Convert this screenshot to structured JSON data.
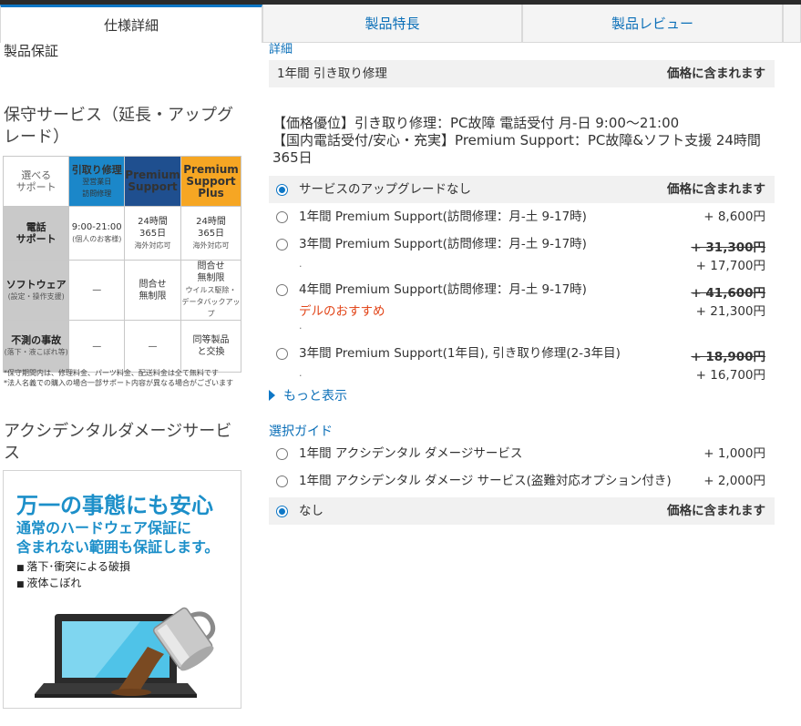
{
  "tabs": [
    {
      "label": "仕様詳細"
    },
    {
      "label": "製品特長"
    },
    {
      "label": "製品レビュー"
    }
  ],
  "left": {
    "warranty_heading": "製品保証",
    "maintenance_heading": "保守サービス（延長・アップグレード）",
    "table": {
      "corner": "選べる\nサポート",
      "col1": {
        "title": "引取り修理",
        "sub": "翌営業日\n訪問修理"
      },
      "col2": {
        "title": "Premium\nSupport"
      },
      "col3": {
        "title": "Premium\nSupport\nPlus"
      },
      "rows": [
        {
          "head": "電話\nサポート",
          "sub": "",
          "c1": "9:00-21:00",
          "c1s": "(個人のお客様)",
          "c2": "24時間\n365日",
          "c2s": "海外対応可",
          "c3": "24時間\n365日",
          "c3s": "海外対応可"
        },
        {
          "head": "ソフトウェア",
          "sub": "(設定・操作支援)",
          "c1": "—",
          "c1s": "",
          "c2": "問合せ\n無制限",
          "c2s": "",
          "c3": "問合せ\n無制限",
          "c3s": "ウイルス駆除・\nデータバックアップ"
        },
        {
          "head": "不測の事故",
          "sub": "(落下・液こぼれ等)",
          "c1": "—",
          "c1s": "",
          "c2": "—",
          "c2s": "",
          "c3": "同等製品\nと交換",
          "c3s": ""
        }
      ],
      "notes": "*保守期間内は、修理料金、パーツ料金、配送料金は全て無料です\n*法人名義での購入の場合一部サポート内容が異なる場合がございます"
    },
    "accidental_heading": "アクシデンタルダメージサービス",
    "promo": {
      "title": "万一の事態にも安心",
      "sub": "通常のハードウェア保証に\n含まれない範囲も保証します。",
      "bullets": [
        "落下･衝突による破損",
        "液体こぼれ"
      ]
    }
  },
  "right": {
    "detail_label": "詳細",
    "warranty_row": {
      "text": "1年間 引き取り修理",
      "price": "価格に含まれます"
    },
    "info_lines": [
      "【価格優位】引き取り修理：PC故障 電話受付 月-日 9:00～21:00",
      "【国内電話受付/安心・充実】Premium Support：PC故障&ソフト支援 24時間365日"
    ],
    "options": [
      {
        "label": "サービスのアップグレードなし",
        "price": "価格に含まれます",
        "selected": true
      },
      {
        "label": "1年間 Premium Support(訪問修理：月-土 9-17時)",
        "price": "+ 8,600円",
        "selected": false
      },
      {
        "label": "3年間 Premium Support(訪問修理：月-土 9-17時)",
        "old_price": "+ 31,300円",
        "price": "+ 17,700円",
        "dot": ".",
        "selected": false
      },
      {
        "label": "4年間 Premium Support(訪問修理：月-土 9-17時)",
        "recommend": "デルのおすすめ",
        "old_price": "+ 41,600円",
        "price": "+ 21,300円",
        "dot": ".",
        "selected": false
      },
      {
        "label": "3年間 Premium Support(1年目), 引き取り修理(2-3年目)",
        "old_price": "+ 18,900円",
        "price": "+ 16,700円",
        "dot": ".",
        "selected": false
      }
    ],
    "more_label": "もっと表示",
    "guide_label": "選択ガイド",
    "accidental": [
      {
        "label": "1年間 アクシデンタル ダメージサービス",
        "price": "+ 1,000円",
        "selected": false
      },
      {
        "label": "1年間 アクシデンタル ダメージ サービス(盗難対応オプション付き)",
        "price": "+ 2,000円",
        "selected": false
      },
      {
        "label": "なし",
        "price": "価格に含まれます",
        "selected": true
      }
    ]
  },
  "colors": {
    "accent": "#0e77c6",
    "link": "#0b6fb8",
    "recommend": "#e2461a",
    "orange": "#f6a623",
    "navy": "#1f4f8f"
  }
}
